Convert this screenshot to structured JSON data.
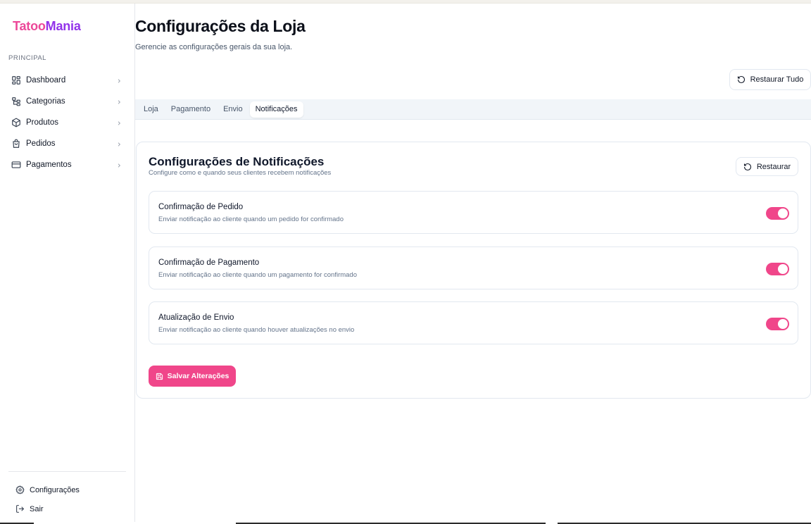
{
  "brand": {
    "part1": "Tatoo",
    "part2": "Mania"
  },
  "sidebar": {
    "section_label": "PRINCIPAL",
    "items": [
      {
        "label": "Dashboard",
        "icon": "dashboard-icon"
      },
      {
        "label": "Categorias",
        "icon": "categories-icon"
      },
      {
        "label": "Produtos",
        "icon": "box-icon"
      },
      {
        "label": "Pedidos",
        "icon": "shopping-bag-icon"
      },
      {
        "label": "Pagamentos",
        "icon": "credit-card-icon"
      }
    ],
    "bottom_items": [
      {
        "label": "Configurações",
        "icon": "gear-icon"
      },
      {
        "label": "Sair",
        "icon": "logout-icon"
      }
    ]
  },
  "header": {
    "title": "Configurações da Loja",
    "subtitle": "Gerencie as configurações gerais da sua loja.",
    "restore_all_label": "Restaurar Tudo"
  },
  "tabs": [
    {
      "label": "Loja",
      "active": false
    },
    {
      "label": "Pagamento",
      "active": false
    },
    {
      "label": "Envio",
      "active": false
    },
    {
      "label": "Notificações",
      "active": true
    }
  ],
  "card": {
    "title": "Configurações de Notificações",
    "description": "Configure como e quando seus clientes recebem notificações",
    "restore_label": "Restaurar",
    "settings": [
      {
        "title": "Confirmação de Pedido",
        "description": "Enviar notificação ao cliente quando um pedido for confirmado",
        "enabled": true
      },
      {
        "title": "Confirmação de Pagamento",
        "description": "Enviar notificação ao cliente quando um pagamento for confirmado",
        "enabled": true
      },
      {
        "title": "Atualização de Envio",
        "description": "Enviar notificação ao cliente quando houver atualizações no envio",
        "enabled": true
      }
    ],
    "save_label": "Salvar Alterações"
  },
  "colors": {
    "accent": "#f0468a",
    "brand_pink": "#ec4899",
    "brand_purple": "#9333ea"
  }
}
